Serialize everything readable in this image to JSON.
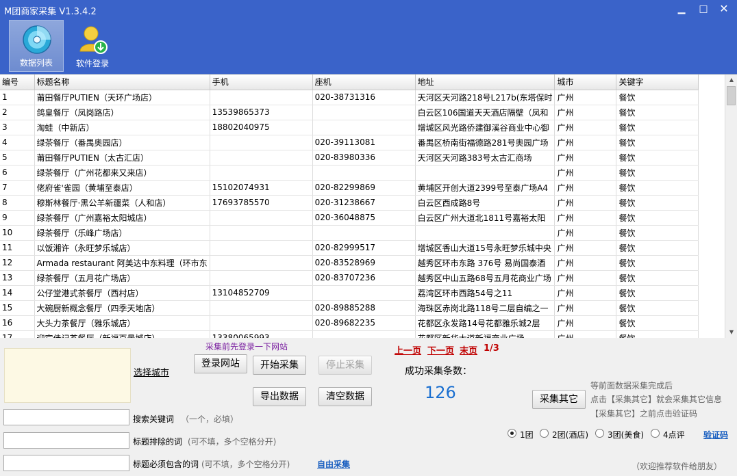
{
  "window": {
    "title": "M团商家采集 V1.3.4.2",
    "minimize": "▁",
    "maximize": "□",
    "close": "✕"
  },
  "toolbar": [
    {
      "label": "数据列表",
      "icon": "disc-icon"
    },
    {
      "label": "软件登录",
      "icon": "user-download-icon"
    }
  ],
  "table": {
    "columns": [
      "编号",
      "标题名称",
      "手机",
      "座机",
      "地址",
      "城市",
      "关键字"
    ],
    "rows": [
      [
        "1",
        "莆田餐厅PUTIEN（天环广场店）",
        "",
        "020-38731316",
        "天河区天河路218号L217b(东塔保时",
        "广州",
        "餐饮"
      ],
      [
        "2",
        "鸽皇餐厅（凤岗路店）",
        "13539865373",
        "",
        "白云区106国道天天酒店隔壁（凤和",
        "广州",
        "餐饮"
      ],
      [
        "3",
        "淘蛙（中新店）",
        "18802040975",
        "",
        "增城区风光路侨建御溪谷商业中心御",
        "广州",
        "餐饮"
      ],
      [
        "4",
        "绿茶餐厅（番禺奥园店）",
        "",
        "020-39113081",
        "番禺区桥南街福德路281号奥园广场",
        "广州",
        "餐饮"
      ],
      [
        "5",
        "莆田餐厅PUTIEN（太古汇店）",
        "",
        "020-83980336",
        "天河区天河路383号太古汇商场",
        "广州",
        "餐饮"
      ],
      [
        "6",
        "绿茶餐厅（广州花都来又来店）",
        "",
        "",
        "",
        "广州",
        "餐饮"
      ],
      [
        "7",
        "佬府雀'雀园（黄埔至泰店）",
        "15102074931",
        "020-82299869",
        "黄埔区开创大道2399号至泰广场A4",
        "广州",
        "餐饮"
      ],
      [
        "8",
        "穆斯林餐厅·黑公羊新疆菜（人和店）",
        "17693785570",
        "020-31238667",
        "白云区西成路8号",
        "广州",
        "餐饮"
      ],
      [
        "9",
        "绿茶餐厅（广州嘉裕太阳城店）",
        "",
        "020-36048875",
        "白云区广州大道北1811号嘉裕太阳",
        "广州",
        "餐饮"
      ],
      [
        "10",
        "绿茶餐厅（乐峰广场店）",
        "",
        "",
        "",
        "广州",
        "餐饮"
      ],
      [
        "11",
        "以饭湘许（永旺梦乐城店）",
        "",
        "020-82999517",
        "增城区香山大道15号永旺梦乐城中央",
        "广州",
        "餐饮"
      ],
      [
        "12",
        "Armada restaurant 阿美达中东料理（环市东",
        "",
        "020-83528969",
        "越秀区环市东路 376号 易尚国泰酒",
        "广州",
        "餐饮"
      ],
      [
        "13",
        "绿茶餐厅（五月花广场店）",
        "",
        "020-83707236",
        "越秀区中山五路68号五月花商业广场",
        "广州",
        "餐饮"
      ],
      [
        "14",
        "公仔堂港式茶餐厅（西村店）",
        "13104852709",
        "",
        "荔湾区环市西路54号之11",
        "广州",
        "餐饮"
      ],
      [
        "15",
        "大碗厨新概念餐厅（四季天地店）",
        "",
        "020-89885288",
        "海珠区赤岗北路118号二层自编之一",
        "广州",
        "餐饮"
      ],
      [
        "16",
        "大头力茶餐厅（雅乐城店）",
        "",
        "020-89682235",
        "花都区永发路14号花都雅乐城2层",
        "广州",
        "餐饮"
      ],
      [
        "17",
        "迎宾佳记茶餐厅（新福百景城店）",
        "13380065993",
        "",
        "花都区新华大道新福商业广场",
        "广州",
        "餐饮"
      ]
    ]
  },
  "panel": {
    "select_city": "选择城市",
    "login_hint": "采集前先登录一下网站",
    "btn_login_site": "登录网站",
    "btn_start": "开始采集",
    "btn_stop": "停止采集",
    "btn_export": "导出数据",
    "btn_clear": "清空数据",
    "pager_prev": "上一页",
    "pager_next": "下一页",
    "pager_last": "末页",
    "pager_status": "1/3",
    "success_label": "成功采集条数：",
    "success_count": "126",
    "btn_collect_other": "采集其它",
    "tip1": "等前面数据采集完成后",
    "tip2": "点击【采集其它】就会采集其它信息",
    "tip3": "【采集其它】之前点击验证码",
    "kw_label": "搜索关键词",
    "kw_hint": "（一个，必填）",
    "exclude_label": "标题排除的词",
    "exclude_hint": "(可不填，多个空格分开)",
    "include_label": "标题必须包含的词",
    "include_hint": "(可不填，多个空格分开)",
    "free_collect": "自由采集",
    "radio_options": [
      "1团",
      "2团(酒店)",
      "3团(美食)",
      "4点评"
    ],
    "radio_selected": 0,
    "captcha": "验证码",
    "recommend": "（欢迎推荐软件给朋友）"
  }
}
